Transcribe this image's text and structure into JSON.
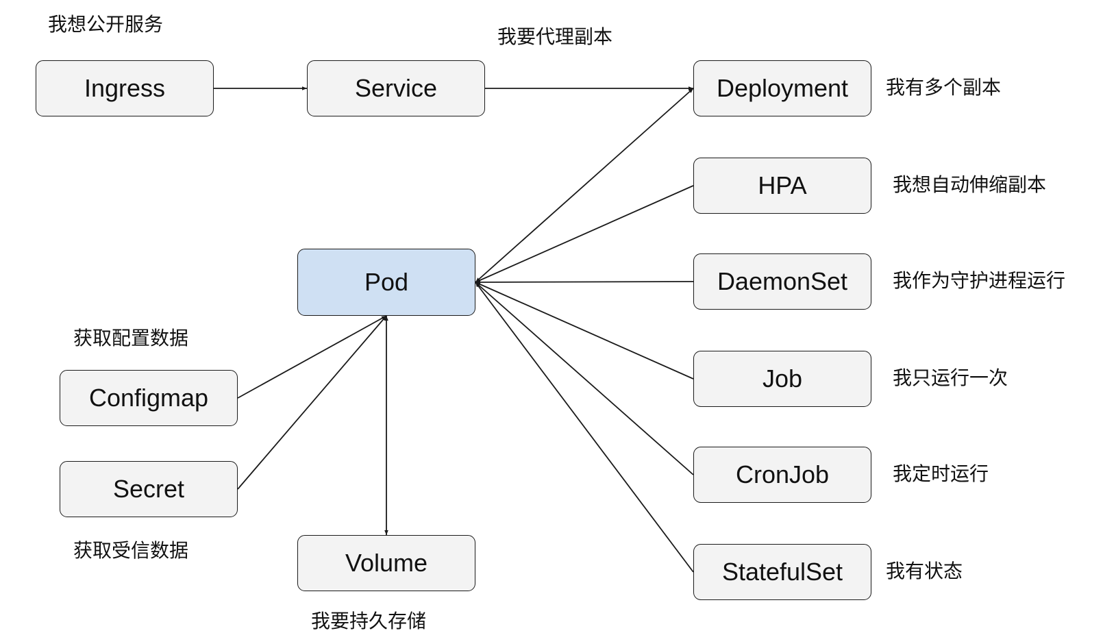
{
  "colors": {
    "node_fill": "#f3f3f3",
    "pod_fill": "#cfe0f3",
    "stroke": "#1a1a1a"
  },
  "nodes": {
    "ingress": "Ingress",
    "service": "Service",
    "deployment": "Deployment",
    "hpa": "HPA",
    "daemonset": "DaemonSet",
    "job": "Job",
    "cronjob": "CronJob",
    "statefulset": "StatefulSet",
    "pod": "Pod",
    "configmap": "Configmap",
    "secret": "Secret",
    "volume": "Volume"
  },
  "notes": {
    "ingress": "我想公开服务",
    "service": "我要代理副本",
    "deployment": "我有多个副本",
    "hpa": "我想自动伸缩副本",
    "daemonset": "我作为守护进程运行",
    "job": "我只运行一次",
    "cronjob": "我定时运行",
    "statefulset": "我有状态",
    "configmap": "获取配置数据",
    "secret": "获取受信数据",
    "volume": "我要持久存储"
  },
  "edges": [
    {
      "from": "ingress",
      "to": "service",
      "arrow": "end"
    },
    {
      "from": "service",
      "to": "deployment",
      "arrow": "end"
    },
    {
      "from": "deployment",
      "to": "pod",
      "arrow": "both"
    },
    {
      "from": "hpa",
      "to": "pod",
      "arrow": "end"
    },
    {
      "from": "daemonset",
      "to": "pod",
      "arrow": "end"
    },
    {
      "from": "job",
      "to": "pod",
      "arrow": "end"
    },
    {
      "from": "cronjob",
      "to": "pod",
      "arrow": "end"
    },
    {
      "from": "statefulset",
      "to": "pod",
      "arrow": "end"
    },
    {
      "from": "configmap",
      "to": "pod",
      "arrow": "end"
    },
    {
      "from": "secret",
      "to": "pod",
      "arrow": "end"
    },
    {
      "from": "pod",
      "to": "volume",
      "arrow": "both"
    }
  ]
}
